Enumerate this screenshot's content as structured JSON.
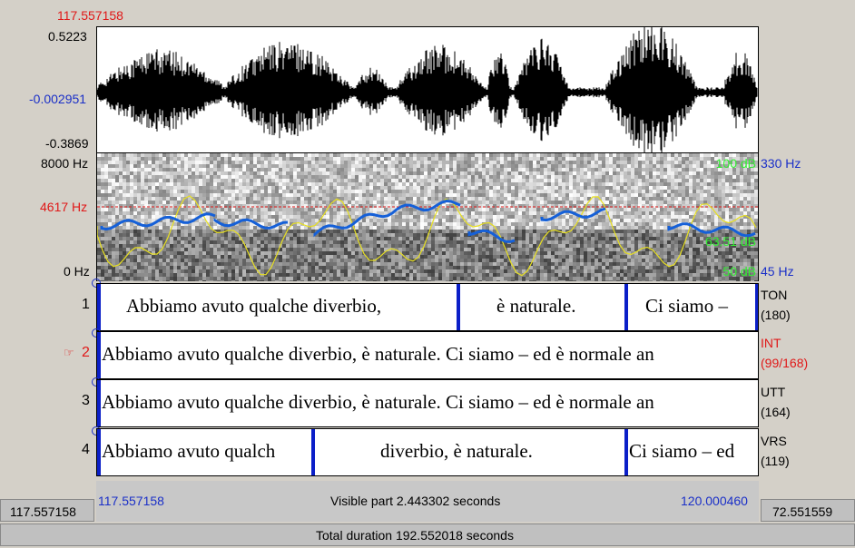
{
  "window": {
    "cursor_time": "117.557158"
  },
  "waveform": {
    "max_label": "0.5223",
    "zero_label": "-0.002951",
    "min_label": "-0.3869"
  },
  "spectrogram": {
    "top_freq": "8000 Hz",
    "cursor_freq": "4617 Hz",
    "bottom_freq": "0 Hz",
    "top_db": "100 dB",
    "mid_db": "63.51 dB",
    "bottom_db": "50 dB",
    "pitch_top": "330 Hz",
    "pitch_bottom": "45 Hz"
  },
  "tiers": [
    {
      "number": "1",
      "name": "TON",
      "count": "(180)",
      "selected": false,
      "segments": [
        "Abbiamo avuto qualche diverbio,",
        "è naturale.",
        "Ci siamo –"
      ]
    },
    {
      "number": "2",
      "name": "INT",
      "count": "(99/168)",
      "selected": true,
      "hand": "☞",
      "segments": [
        "Abbiamo avuto qualche diverbio, è naturale. Ci siamo – ed è normale an"
      ]
    },
    {
      "number": "3",
      "name": "UTT",
      "count": "(164)",
      "selected": false,
      "segments": [
        "Abbiamo avuto qualche diverbio, è naturale. Ci siamo – ed è normale an"
      ]
    },
    {
      "number": "4",
      "name": "VRS",
      "count": "(119)",
      "selected": false,
      "segments": [
        "Abbiamo avuto qualch",
        "diverbio, è naturale.",
        "Ci siamo – ed"
      ]
    }
  ],
  "footer": {
    "left_total": "117.557158",
    "visible_start": "117.557158",
    "visible_label": "Visible part 2.443302 seconds",
    "visible_end": "120.000460",
    "right_total": "72.551559",
    "total_label": "Total duration 192.552018 seconds"
  },
  "colors": {
    "boundary": "#0b1fc8",
    "pitch": "#1560d8",
    "intensity": "#e8e020",
    "cursor": "#e01818"
  }
}
